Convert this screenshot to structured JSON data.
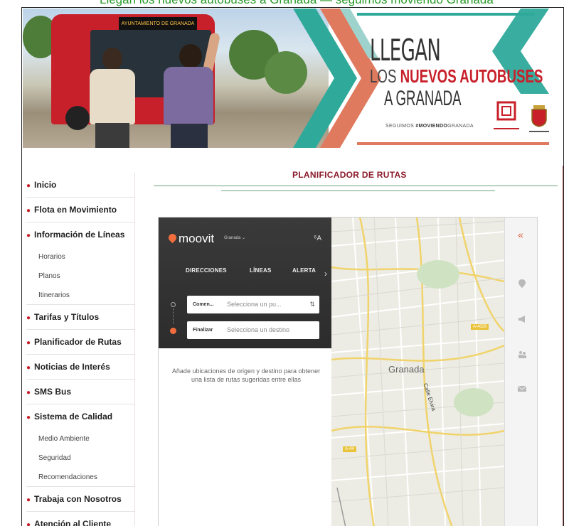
{
  "banner": {
    "title_line1": "LLEGAN",
    "title_line2a": "LOS ",
    "title_line2b": "NUEVOS AUTOBUSES",
    "title_line3": "A GRANADA",
    "tagline_pre": "SEGUIMOS ",
    "tagline_bold": "#MOVIENDO",
    "tagline_post": "GRANADA",
    "bus_sign": "AYUNTAMIENTO DE GRANADA",
    "colors": {
      "teal": "#2ea99a",
      "salmon": "#e07a5f",
      "red": "#c8202a"
    }
  },
  "sidebar": {
    "items": [
      {
        "label": "Inicio"
      },
      {
        "label": "Flota en Movimiento"
      },
      {
        "label": "Información de Líneas",
        "sub": [
          "Horarios",
          "Planos",
          "Itinerarios"
        ]
      },
      {
        "label": "Tarifas y Títulos"
      },
      {
        "label": "Planificador de Rutas"
      },
      {
        "label": "Noticias de Interés"
      },
      {
        "label": "SMS Bus"
      },
      {
        "label": "Sistema de Calidad",
        "sub": [
          "Medio Ambiente",
          "Seguridad",
          "Recomendaciones"
        ]
      },
      {
        "label": "Trabaja con Nosotros"
      },
      {
        "label": "Atención al Cliente"
      }
    ]
  },
  "main": {
    "title": "PLANIFICADOR DE RUTAS"
  },
  "widget": {
    "brand": "moovit",
    "city": "Granada ⌄",
    "lang_icon": "translate-icon",
    "tabs": [
      "DIRECCIONES",
      "LÍNEAS",
      "ALERTA"
    ],
    "origin_label": "Comen...",
    "origin_placeholder": "Selecciona un pu...",
    "dest_label": "Finalizar",
    "dest_placeholder": "Selecciona un destino",
    "hint": "Añade ubicaciones de origen y destino para obtener una lista de rutas sugeridas entre ellas",
    "accent": "#f26d3d",
    "map": {
      "city_label": "Granada",
      "street_label": "Calle Elvira",
      "road_a": "A-4026",
      "road_b": "A-44"
    },
    "rail_icons": [
      "collapse-icon",
      "location-icon",
      "megaphone-icon",
      "people-icon",
      "mail-icon"
    ]
  }
}
